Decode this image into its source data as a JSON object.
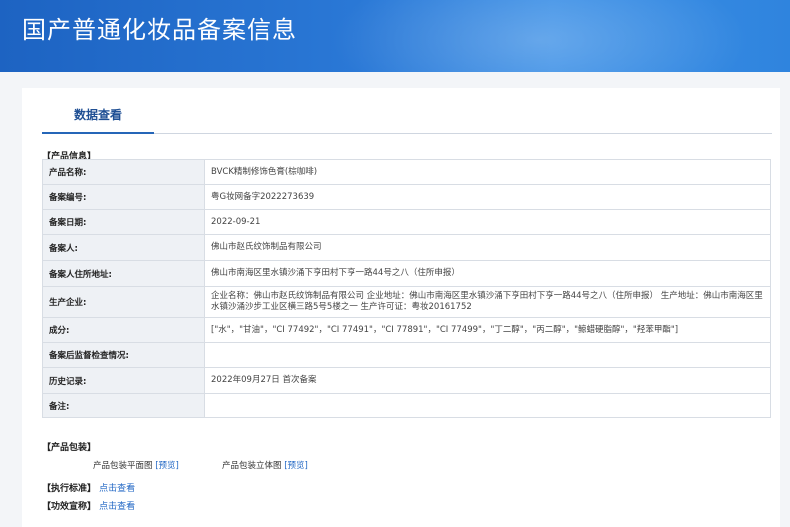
{
  "header": {
    "title": "国产普通化妆品备案信息"
  },
  "tabs": [
    {
      "label": "数据查看"
    }
  ],
  "product_section": {
    "title": "【产品信息】",
    "rows": [
      {
        "label": "产品名称:",
        "value": "BVCK精制修饰色膏(棕咖啡)"
      },
      {
        "label": "备案编号:",
        "value": "粤G妆网备字2022273639"
      },
      {
        "label": "备案日期:",
        "value": "2022-09-21"
      },
      {
        "label": "备案人:",
        "value": "佛山市赵氏纹饰制品有限公司"
      },
      {
        "label": "备案人住所地址:",
        "value": "佛山市南海区里水镇沙涌下亨田村下亨一路44号之八（住所申报）"
      },
      {
        "label": "生产企业:",
        "value": "企业名称：佛山市赵氏纹饰制品有限公司 企业地址：佛山市南海区里水镇沙涌下亨田村下亨一路44号之八（住所申报） 生产地址：佛山市南海区里水镇沙涌沙步工业区横三路5号5楼之一 生产许可证：粤妆20161752"
      },
      {
        "label": "成分:",
        "value": "[\"水\"，\"甘油\"，\"CI 77492\"，\"CI 77491\"，\"CI 77891\"，\"CI 77499\"，\"丁二醇\"，\"丙二醇\"，\"鲸蜡硬脂醇\"，\"羟苯甲酯\"]"
      },
      {
        "label": "备案后监督检查情况:",
        "value": ""
      },
      {
        "label": "历史记录:",
        "value": "2022年09月27日 首次备案"
      },
      {
        "label": "备注:",
        "value": ""
      }
    ]
  },
  "packaging_section": {
    "title": "【产品包装】",
    "flat_label": "产品包装平面图",
    "flat_link": "[预览]",
    "stereo_label": "产品包装立体图",
    "stereo_link": "[预览]"
  },
  "standard_section": {
    "title": "【执行标准】",
    "link": "点击查看"
  },
  "efficacy_section": {
    "title": "【功效宣称】",
    "link": "点击查看"
  }
}
